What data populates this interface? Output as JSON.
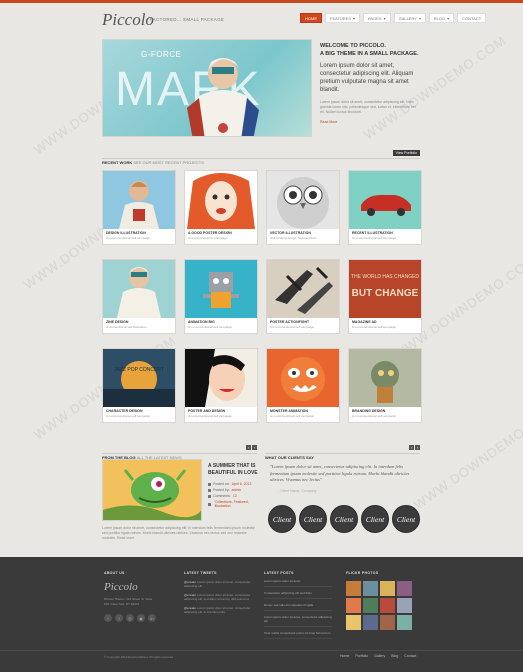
{
  "brand": {
    "logo": "Piccolo",
    "tagline": "FACTORED... SMALL PACKAGE"
  },
  "nav": [
    {
      "label": "HOME",
      "active": true
    },
    {
      "label": "FEATURES",
      "active": false
    },
    {
      "label": "PAGES",
      "active": false
    },
    {
      "label": "GALLERY",
      "active": false
    },
    {
      "label": "BLOG",
      "active": false
    },
    {
      "label": "CONTACT",
      "active": false
    }
  ],
  "hero": {
    "image_small_text": "G-FORCE",
    "image_word": "MARK",
    "title_line1": "WELCOME TO PICCOLO.",
    "title_line2": "A BIG THEME IN A SMALL PACKAGE.",
    "body": "Lorem ipsum dolor sit amet, consectetur adipiscing elit. Aliquam pretium vulputate magna sit amet blandit.",
    "small": "Lorem ipsum dolor sit amet, consectetur adipiscing elit. Nam gravida lorem nisi, pellentesque sed, luctus et, elementum vel mi. Nullam luctus tincidunt.",
    "read_more": "Read More"
  },
  "recent_work": {
    "label": "RECENT WORK",
    "sub": "SEE OUR MOST RECENT PROJECTS",
    "button": "View Portfolio"
  },
  "portfolio": [
    {
      "title": "DESIGN ILLUSTRATION",
      "sub": "An unconventional self campaign",
      "thumb": "astronaut"
    },
    {
      "title": "A GOOD POSTER DESIGN",
      "sub": "Unconventional fox campaign",
      "thumb": "redhead"
    },
    {
      "title": "VECTOR ILLUSTRATION",
      "sub": "Owl coloring design, Nestcall Devil",
      "thumb": "owl"
    },
    {
      "title": "RECENT ILLUSTRATION",
      "sub": "An unconventional self campaign",
      "thumb": "car"
    },
    {
      "title": "ZINE DESIGN",
      "sub": "Unconventional self illustration",
      "thumb": "astronaut2"
    },
    {
      "title": "ANIMATION BIG",
      "sub": "An unconventional self campaign",
      "thumb": "robot"
    },
    {
      "title": "POSTER ACTIONFIGHT",
      "sub": "An unconventional self campaign",
      "thumb": "planes"
    },
    {
      "title": "MAGAZINE AD",
      "sub": "An unconventional self campaign",
      "thumb": "change"
    },
    {
      "title": "CHARACTER DESIGN",
      "sub": "An unconventional self campaign",
      "thumb": "jazz"
    },
    {
      "title": "POSTER AND DESIGN",
      "sub": "An unconventional self campaign",
      "thumb": "popart"
    },
    {
      "title": "MONSTER ANIMATION",
      "sub": "An unconventional self campaign",
      "thumb": "monster"
    },
    {
      "title": "BRANDING DESIGN",
      "sub": "An unconventional self campaign",
      "thumb": "robot2"
    }
  ],
  "thumb_text": {
    "change_1": "BUT CHANGE",
    "jazz": "JAZZ POP CONCERT"
  },
  "blog_section": {
    "label": "FROM THE BLOG",
    "sub": "ALL THE LATEST NEWS"
  },
  "blog": {
    "title": "A SUMMER THAT IS BEAUTIFUL IN LOVE",
    "meta": [
      {
        "label": "Posted on:",
        "value": "April 6, 2013"
      },
      {
        "label": "Posted by:",
        "value": "admin"
      },
      {
        "label": "Comments:",
        "value": "12"
      },
      {
        "label": "",
        "value": "Collections, Featured, Illustration"
      }
    ],
    "excerpt": "Lorem ipsum dolor sit amet, consectetur adipiscing elit. In interdum felis fermentum ipsum molestie sed porttitor ligula rutrum. Morbi blandit ultricies ultrices. Vivamus nec lectus sed orci molestie molestie. Read more"
  },
  "testimonials": {
    "label": "WHAT OUR CLIENTS SAY",
    "sub": "",
    "quote": "\"Lorem ipsum dolor sit amet, consectetur adipiscing elit. In interdum felis fermentum ipsum molestie sed porttitor ligula rutrum. Morbi blandit ultricies ultrices. Vivamus nec lectus\"",
    "author": "- Client Name, Company"
  },
  "clients": [
    "Client",
    "Client",
    "Client",
    "Client",
    "Client"
  ],
  "footer": {
    "about": {
      "heading": "ABOUT US",
      "logo": "Piccolo",
      "address": "Piccolo Theme / 123 Street St, Suite 100 / New York, NY 10001"
    },
    "tweets": {
      "heading": "LATEST TWEETS",
      "items": [
        {
          "user": "@envato",
          "text": "Lorem ipsum dolor sit amet, consectetur adipiscing elit."
        },
        {
          "user": "@envato",
          "text": "Lorem ipsum dolor sit amet, consectetur adipiscing elit, sed diam nonummy nibh euismod."
        },
        {
          "user": "@envato",
          "text": "Lorem ipsum dolor sit amet, consectetur adipiscing elit. In interdum felis."
        }
      ]
    },
    "posts": {
      "heading": "LATEST POSTS",
      "items": [
        "Lorem ipsum dolor sit amet",
        "Consectetur adipiscing elit sed diam",
        "Donec sed odio dui vulputate fringilla",
        "Lorem ipsum dolor sit amet, consectetur adipiscing elit",
        "Cras mattis consectetur purus sit amet fermentum"
      ]
    },
    "flickr": {
      "heading": "FLICKR PHOTOS"
    },
    "copyright": "© Copyright 2013 Envato Market. All rights reserved.",
    "nav": [
      "Home",
      "Portfolio",
      "Gallery",
      "Blog",
      "Contact"
    ]
  },
  "social_icons": [
    "twitter-icon",
    "facebook-icon",
    "dribbble-icon",
    "rss-icon",
    "linkedin-icon"
  ],
  "colors": {
    "accent": "#d0471d",
    "footer": "#3a3a3a",
    "background": "#e9e7e4"
  }
}
